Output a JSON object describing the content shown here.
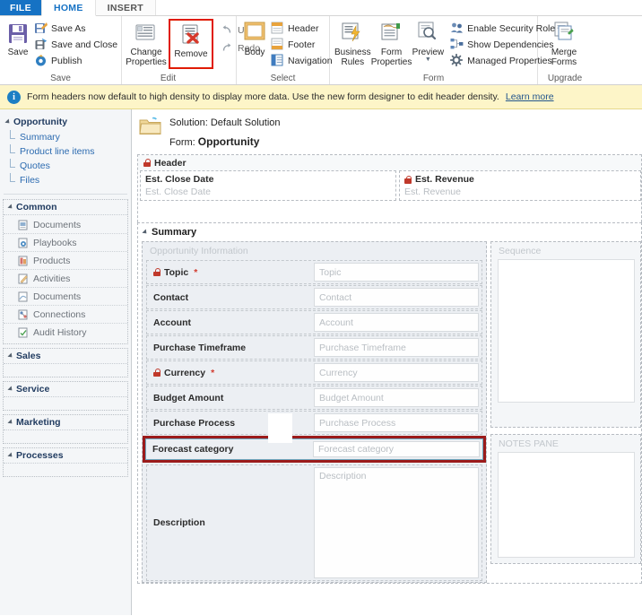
{
  "window": {
    "tabs": [
      {
        "id": "file",
        "label": "FILE"
      },
      {
        "id": "home",
        "label": "HOME"
      },
      {
        "id": "insert",
        "label": "INSERT"
      }
    ]
  },
  "ribbon": {
    "groups": [
      {
        "name": "save",
        "label": "Save",
        "big": [
          {
            "label": "Save",
            "icon": "save-disk-icon"
          }
        ],
        "small": [
          {
            "label": "Save As",
            "icon": "save-as-icon"
          },
          {
            "label": "Save and Close",
            "icon": "save-and-close-icon"
          },
          {
            "label": "Publish",
            "icon": "publish-icon"
          }
        ]
      },
      {
        "name": "edit",
        "label": "Edit",
        "big": [
          {
            "label": "Change Properties",
            "icon": "change-properties-icon"
          },
          {
            "label": "Remove",
            "icon": "remove-icon",
            "highlighted": true
          }
        ],
        "small": [
          {
            "label": "Undo",
            "icon": "undo-icon"
          },
          {
            "label": "Redo",
            "icon": "redo-icon"
          }
        ]
      },
      {
        "name": "select",
        "label": "Select",
        "big": [
          {
            "label": "Body",
            "icon": "body-icon"
          }
        ],
        "small": [
          {
            "label": "Header",
            "icon": "header-icon"
          },
          {
            "label": "Footer",
            "icon": "footer-icon"
          },
          {
            "label": "Navigation",
            "icon": "navigation-icon"
          }
        ]
      },
      {
        "name": "form",
        "label": "Form",
        "big": [
          {
            "label": "Business Rules",
            "icon": "business-rules-icon"
          },
          {
            "label": "Form Properties",
            "icon": "form-properties-icon"
          },
          {
            "label": "Preview",
            "icon": "preview-icon",
            "dropdown": true
          }
        ],
        "small": [
          {
            "label": "Enable Security Roles",
            "icon": "security-roles-icon"
          },
          {
            "label": "Show Dependencies",
            "icon": "dependencies-icon"
          },
          {
            "label": "Managed Properties",
            "icon": "managed-properties-icon"
          }
        ]
      },
      {
        "name": "upgrade",
        "label": "Upgrade",
        "big": [
          {
            "label": "Merge Forms",
            "icon": "merge-forms-icon"
          }
        ],
        "small": []
      }
    ]
  },
  "notice": {
    "icon": "info-icon",
    "text": "Form headers now default to high density to display more data. Use the new form designer to edit header density.",
    "link": "Learn more"
  },
  "leftnav": {
    "opportunity": {
      "title": "Opportunity",
      "links": [
        "Summary",
        "Product line items",
        "Quotes",
        "Files"
      ]
    },
    "groups": [
      {
        "title": "Common",
        "items": [
          "Documents",
          "Playbooks",
          "Products",
          "Activities",
          "Documents",
          "Connections",
          "Audit History"
        ]
      },
      {
        "title": "Sales",
        "items": []
      },
      {
        "title": "Service",
        "items": []
      },
      {
        "title": "Marketing",
        "items": []
      },
      {
        "title": "Processes",
        "items": []
      }
    ]
  },
  "canvas": {
    "solution_line": "Solution: Default Solution",
    "form_label": "Form:",
    "form_name": "Opportunity",
    "folder_icon": "folder-icon",
    "header_section": {
      "title": "Header",
      "locked": true,
      "fields": [
        {
          "label": "Est. Close Date",
          "placeholder": "Est. Close Date",
          "locked": false
        },
        {
          "label": "Est. Revenue",
          "placeholder": "Est. Revenue",
          "locked": true
        }
      ]
    },
    "summary_section": {
      "title": "Summary",
      "left_panel_title": "Opportunity Information",
      "fields": [
        {
          "label": "Topic",
          "placeholder": "Topic",
          "locked": true,
          "required": true
        },
        {
          "label": "Contact",
          "placeholder": "Contact",
          "locked": false,
          "required": false
        },
        {
          "label": "Account",
          "placeholder": "Account",
          "locked": false,
          "required": false
        },
        {
          "label": "Purchase Timeframe",
          "placeholder": "Purchase Timeframe",
          "locked": false,
          "required": false
        },
        {
          "label": "Currency",
          "placeholder": "Currency",
          "locked": true,
          "required": true
        },
        {
          "label": "Budget Amount",
          "placeholder": "Budget Amount",
          "locked": false,
          "required": false
        },
        {
          "label": "Purchase Process",
          "placeholder": "Purchase Process",
          "locked": false,
          "required": false
        }
      ],
      "selected_field": {
        "label": "Forecast category",
        "placeholder": "Forecast category",
        "selected": true
      },
      "description_field": {
        "label": "Description",
        "placeholder": "Description"
      },
      "right_panels": [
        {
          "title": "Sequence"
        },
        {
          "title": "NOTES PANE"
        }
      ]
    }
  },
  "colors": {
    "accent_blue": "#1672c4",
    "highlight_red": "#9b1b1b",
    "remove_outline": "#e01b00",
    "notice_bg": "#fdf5c8",
    "lock_red": "#c0392b",
    "required_red": "#d23b2e"
  }
}
